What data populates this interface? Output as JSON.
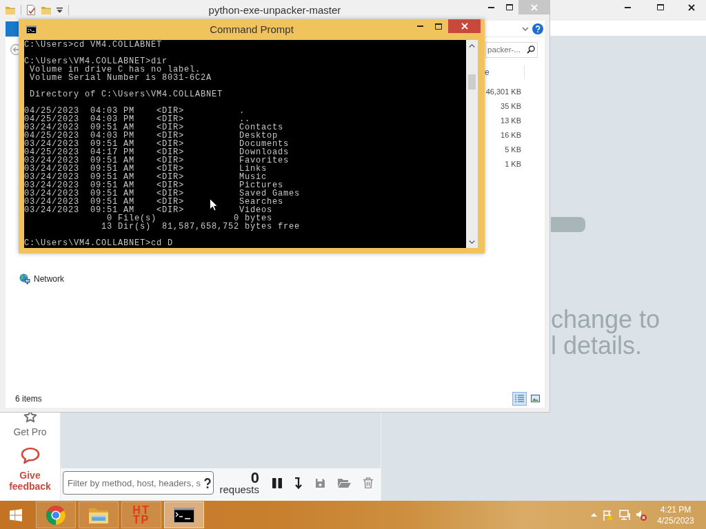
{
  "background_app": {
    "sidebar_items": [
      {
        "kind": "pro",
        "label": "Get Pro"
      },
      {
        "kind": "feedback",
        "label": "Give feedback"
      }
    ],
    "filter": {
      "placeholder": "Filter by method, host, headers, s"
    },
    "request_count": {
      "count": "0",
      "label": "requests"
    },
    "detail_pane": {
      "text": [
        "change to",
        "l details."
      ]
    }
  },
  "explorer": {
    "title": "python-exe-unpacker-master",
    "search": {
      "placeholder": "packer-..."
    },
    "column_header": "e",
    "sizes": [
      "46,301 KB",
      "35 KB",
      "13 KB",
      "16 KB",
      "5 KB",
      "1 KB"
    ],
    "nav_items": [
      {
        "label": "Network"
      }
    ],
    "status_bar": "6 items",
    "view_buttons": [
      {
        "kind": "details",
        "selected": true
      },
      {
        "kind": "large_icons",
        "selected": false
      }
    ]
  },
  "command_prompt": {
    "title": "Command Prompt",
    "blocks": [
      {
        "kind": "text",
        "lines": [
          "C:\\Users>cd VM4.COLLABNET"
        ]
      },
      {
        "kind": "text",
        "lines": [
          "C:\\Users\\VM4.COLLABNET>dir",
          " Volume in drive C has no label.",
          " Volume Serial Number is 8031-6C2A"
        ]
      },
      {
        "kind": "text",
        "lines": [
          " Directory of C:\\Users\\VM4.COLLABNET"
        ]
      },
      {
        "kind": "listing",
        "entries": [
          {
            "date": "04/25/2023",
            "time": "04:03 PM",
            "type": "<DIR>",
            "name": "."
          },
          {
            "date": "04/25/2023",
            "time": "04:03 PM",
            "type": "<DIR>",
            "name": ".."
          },
          {
            "date": "03/24/2023",
            "time": "09:51 AM",
            "type": "<DIR>",
            "name": "Contacts"
          },
          {
            "date": "04/25/2023",
            "time": "04:03 PM",
            "type": "<DIR>",
            "name": "Desktop"
          },
          {
            "date": "03/24/2023",
            "time": "09:51 AM",
            "type": "<DIR>",
            "name": "Documents"
          },
          {
            "date": "04/25/2023",
            "time": "04:17 PM",
            "type": "<DIR>",
            "name": "Downloads"
          },
          {
            "date": "03/24/2023",
            "time": "09:51 AM",
            "type": "<DIR>",
            "name": "Favorites"
          },
          {
            "date": "03/24/2023",
            "time": "09:51 AM",
            "type": "<DIR>",
            "name": "Links"
          },
          {
            "date": "03/24/2023",
            "time": "09:51 AM",
            "type": "<DIR>",
            "name": "Music"
          },
          {
            "date": "03/24/2023",
            "time": "09:51 AM",
            "type": "<DIR>",
            "name": "Pictures"
          },
          {
            "date": "03/24/2023",
            "time": "09:51 AM",
            "type": "<DIR>",
            "name": "Saved Games"
          },
          {
            "date": "03/24/2023",
            "time": "09:51 AM",
            "type": "<DIR>",
            "name": "Searches"
          },
          {
            "date": "03/24/2023",
            "time": "09:51 AM",
            "type": "<DIR>",
            "name": "Videos"
          }
        ],
        "summary": [
          "               0 File(s)              0 bytes",
          "              13 Dir(s)  81,587,658,752 bytes free"
        ]
      },
      {
        "kind": "text",
        "lines": [
          "C:\\Users\\VM4.COLLABNET>cd D"
        ]
      }
    ]
  },
  "taskbar": {
    "items": [
      {
        "kind": "browser",
        "selected": false
      },
      {
        "kind": "files",
        "selected": false
      },
      {
        "kind": "http",
        "text": [
          "HT",
          "TP"
        ],
        "selected": false
      },
      {
        "kind": "terminal",
        "selected": true
      }
    ],
    "clock": {
      "time": "4:21 PM",
      "date": "4/25/2023"
    }
  }
}
